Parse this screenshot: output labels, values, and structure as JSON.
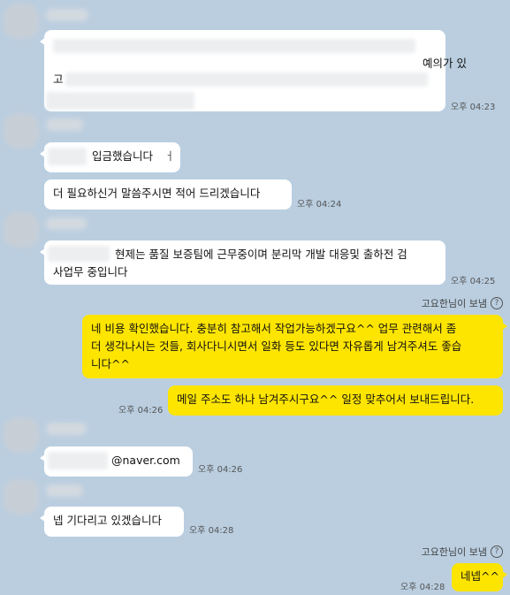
{
  "messages": {
    "m1": {
      "line1_tail": "예의가 있",
      "line2_head": "고",
      "time": "오후 04:23"
    },
    "m2": {
      "text": "입금했습니다",
      "time": ""
    },
    "m3": {
      "text": "더 필요하신거 말씀주시면 적어 드리겠습니다",
      "time": "오후 04:24"
    },
    "m4": {
      "line1": "현제는 품질 보증팀에 근무중이며 분리막 개발 대응및 출하전 검",
      "line2": "사업무 중입니다",
      "time": "오후 04:25"
    },
    "sender1": "고요한님이 보냄",
    "m5": {
      "line1": "네 비용 확인했습니다. 충분히 참고해서 작업가능하겠구요^^ 업무 관련해서 좀",
      "line2": "더 생각나시는 것들, 회사다니시면서 일화 등도 있다면 자유롭게 남겨주셔도 좋습",
      "line3": "니다^^"
    },
    "m6": {
      "text": "메일 주소도 하나 남겨주시구요^^ 일정 맞추어서 보내드립니다.",
      "time": "오후 04:26"
    },
    "m7": {
      "text": "@naver.com",
      "time": "오후 04:26"
    },
    "m8": {
      "text": "넵 기다리고 있겠습니다",
      "time": "오후 04:28"
    },
    "sender2": "고요한님이 보냄",
    "m9": {
      "text": "네넵^^",
      "time": "오후 04:28"
    }
  },
  "icons": {
    "help": "?"
  }
}
